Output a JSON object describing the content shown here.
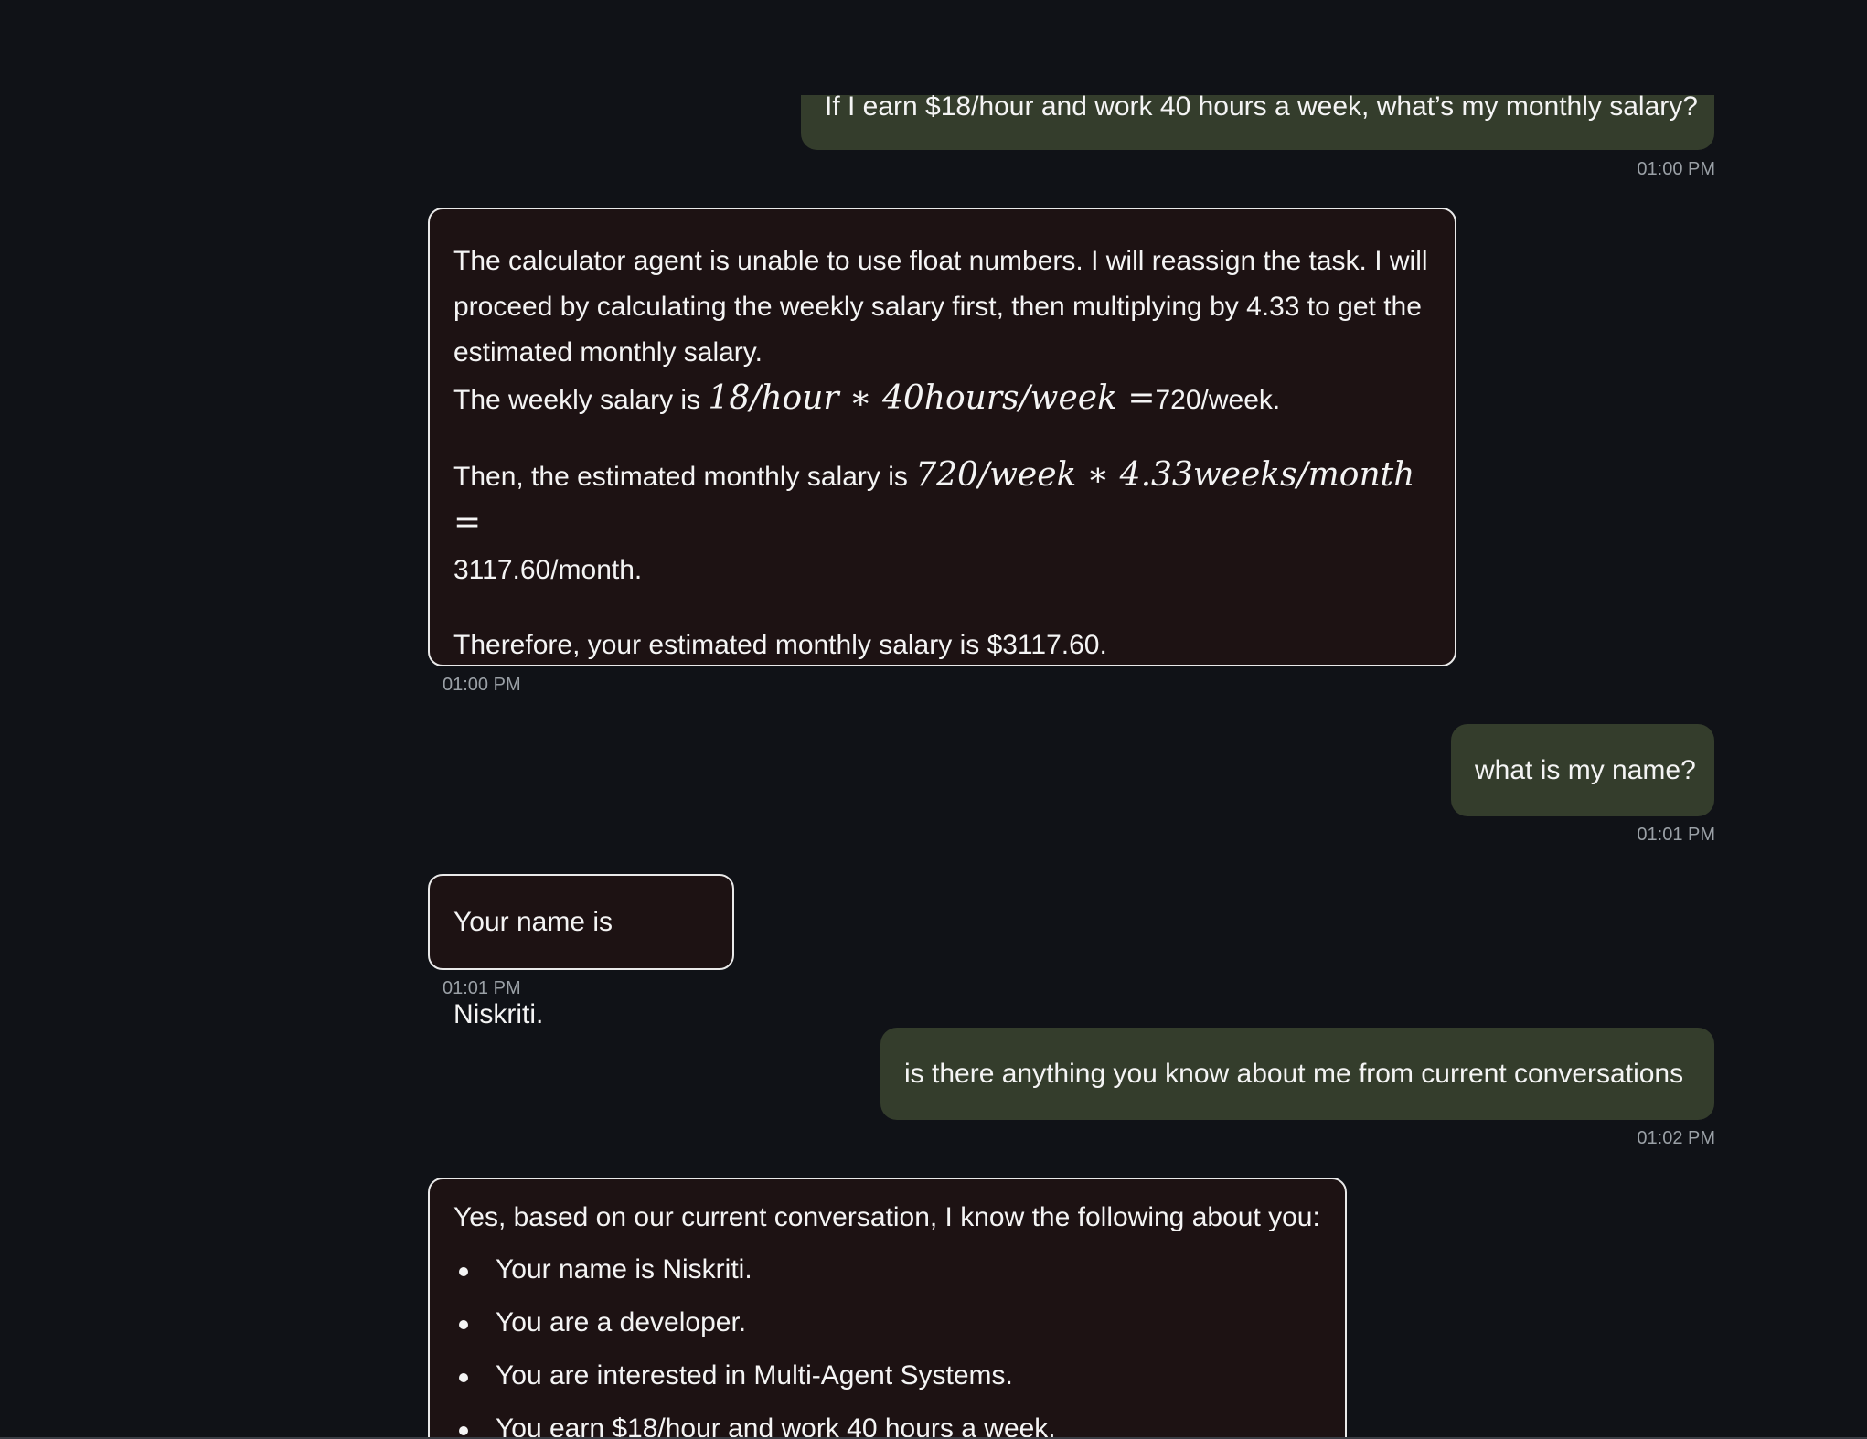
{
  "messages": {
    "m1": {
      "role": "user",
      "text": "If I earn $18/hour and work 40 hours a week, what’s my monthly salary?",
      "time": "01:00 PM"
    },
    "m2": {
      "role": "assistant",
      "line1": "The calculator agent is unable to use float numbers. I will reassign the task. I will",
      "line2": "proceed by calculating the weekly salary first, then multiplying by 4.33 to get the",
      "line3": "estimated monthly salary.",
      "weekly_prefix": "The weekly salary is ",
      "weekly_math": "18/hour ∗ 40hours/week =",
      "weekly_suffix": "720/week.",
      "monthly_prefix": "Then, the estimated monthly salary is ",
      "monthly_math": "720/week ∗ 4.33weeks/month =",
      "monthly_suffix": "3117.60/month.",
      "conclusion": "Therefore, your estimated monthly salary is $3117.60.",
      "time": "01:00 PM"
    },
    "m3": {
      "role": "user",
      "text": "what is my name?",
      "time": "01:01 PM"
    },
    "m4": {
      "role": "assistant",
      "text": "Your name is Niskriti.",
      "time": "01:01 PM"
    },
    "m5": {
      "role": "user",
      "text": "is there anything you know about me from current conversations",
      "time": "01:02 PM"
    },
    "m6": {
      "role": "assistant",
      "intro": "Yes, based on our current conversation, I know the following about you:",
      "items": [
        "Your name is Niskriti.",
        "You are a developer.",
        "You are interested in Multi-Agent Systems.",
        "You earn $18/hour and work 40 hours a week."
      ]
    }
  }
}
